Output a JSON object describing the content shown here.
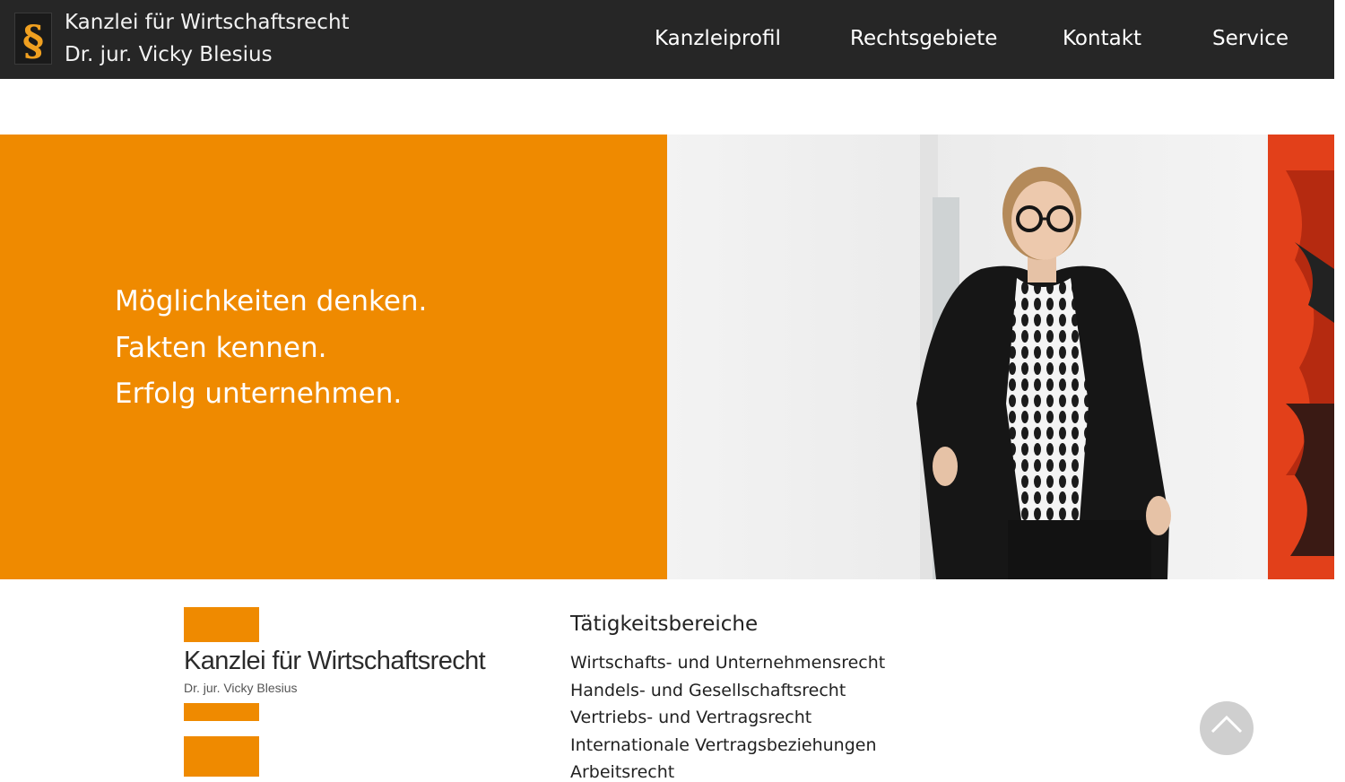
{
  "header": {
    "brand_line1": "Kanzlei für Wirtschaftsrecht",
    "brand_line2": "Dr. jur. Vicky Blesius",
    "logo_icon": "paragraph-icon",
    "nav": [
      "Kanzleiprofil",
      "Rechtsgebiete",
      "Kontakt",
      "Service"
    ]
  },
  "hero": {
    "slogans": [
      "Möglichkeiten denken.",
      "Fakten kennen.",
      "Erfolg unternehmen."
    ],
    "photo_icon": "portrait-photo"
  },
  "logo_block": {
    "title": "Kanzlei für Wirtschaftsrecht",
    "subtitle": "Dr. jur. Vicky Blesius"
  },
  "areas": {
    "heading": "Tätigkeitsbereiche",
    "items": [
      "Wirtschafts- und Unternehmensrecht",
      "Handels- und Gesellschaftsrecht",
      "Vertriebs- und Vertragsrecht",
      "Internationale Vertragsbeziehungen",
      "Arbeitsrecht"
    ]
  },
  "scroll_top_icon": "chevron-up-icon",
  "colors": {
    "header_bg": "#262626",
    "accent_orange": "#ef8a00",
    "scroll_button": "#cfcfcf"
  }
}
